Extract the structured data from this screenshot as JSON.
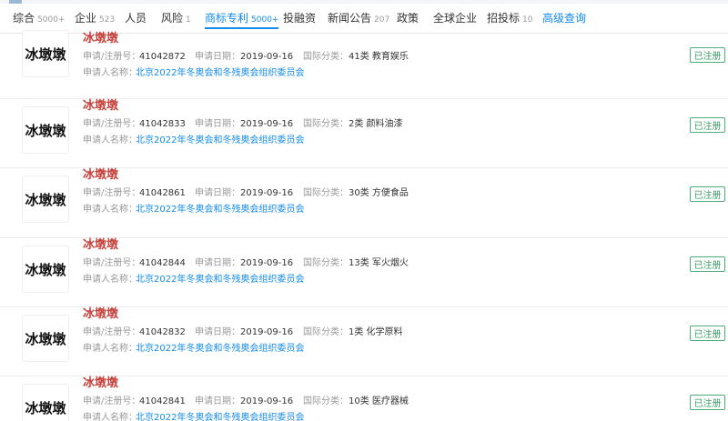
{
  "tabs": [
    {
      "label": "综合",
      "count": "5000+",
      "active": false
    },
    {
      "label": "企业",
      "count": "523",
      "active": false
    },
    {
      "label": "人员",
      "count": "",
      "active": false
    },
    {
      "label": "风险",
      "count": "1",
      "active": false
    },
    {
      "label": "商标专利",
      "count": "5000+",
      "active": true
    },
    {
      "label": "投融资",
      "count": "",
      "active": false
    },
    {
      "label": "新闻公告",
      "count": "207",
      "active": false
    },
    {
      "label": "政策",
      "count": "",
      "active": false
    },
    {
      "label": "全球企业",
      "count": "",
      "active": false
    },
    {
      "label": "招投标",
      "count": "10",
      "active": false
    },
    {
      "label": "高级查询",
      "count": "",
      "active": false,
      "link": true
    }
  ],
  "labels": {
    "reg_no": "申请/注册号：",
    "apply_date": "申请日期：",
    "intl_class": "国际分类：",
    "applicant": "申请人名称："
  },
  "results": [
    {
      "logo_text": "冰墩墩",
      "name": "冰墩墩",
      "reg_no": "41042872",
      "date": "2019-09-16",
      "class": "41类 教育娱乐",
      "applicant": "北京2022年冬奥会和冬残奥会组织委员会",
      "status": "已注册"
    },
    {
      "logo_text": "冰墩墩",
      "name": "冰墩墩",
      "reg_no": "41042833",
      "date": "2019-09-16",
      "class": "2类 颜料油漆",
      "applicant": "北京2022年冬奥会和冬残奥会组织委员会",
      "status": "已注册"
    },
    {
      "logo_text": "冰墩墩",
      "name": "冰墩墩",
      "reg_no": "41042861",
      "date": "2019-09-16",
      "class": "30类 方便食品",
      "applicant": "北京2022年冬奥会和冬残奥会组织委员会",
      "status": "已注册"
    },
    {
      "logo_text": "冰墩墩",
      "name": "冰墩墩",
      "reg_no": "41042844",
      "date": "2019-09-16",
      "class": "13类 军火烟火",
      "applicant": "北京2022年冬奥会和冬残奥会组织委员会",
      "status": "已注册"
    },
    {
      "logo_text": "冰墩墩",
      "name": "冰墩墩",
      "reg_no": "41042832",
      "date": "2019-09-16",
      "class": "1类 化学原料",
      "applicant": "北京2022年冬奥会和冬残奥会组织委员会",
      "status": "已注册"
    },
    {
      "logo_text": "冰墩墩",
      "name": "冰墩墩",
      "reg_no": "41042841",
      "date": "2019-09-16",
      "class": "10类 医疗器械",
      "applicant": "北京2022年冬奥会和冬残奥会组织委员会",
      "status": "已注册"
    }
  ]
}
